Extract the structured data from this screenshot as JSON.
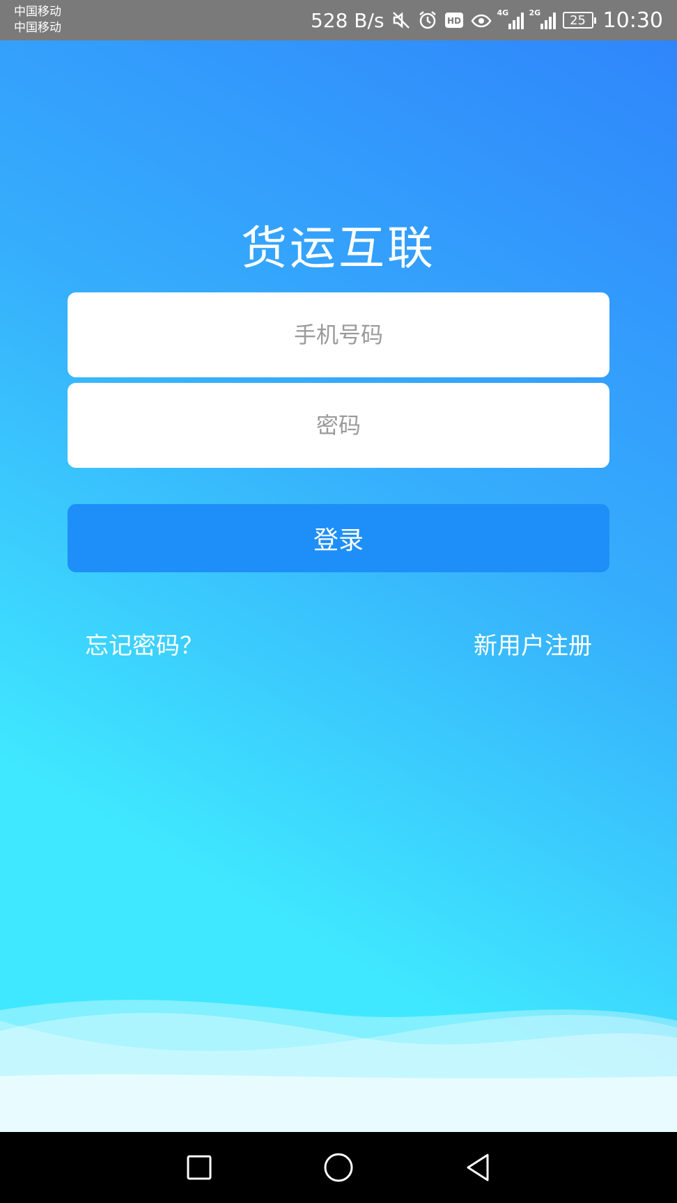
{
  "status_bar": {
    "carrier_1": "中国移动",
    "carrier_2": "中国移动",
    "net_speed": "528 B/s",
    "signal_1_label": "4G",
    "signal_2_label": "2G",
    "battery_level": "25",
    "time": "10:30"
  },
  "app": {
    "title": "货运互联",
    "phone_placeholder": "手机号码",
    "password_placeholder": "密码",
    "login_label": "登录",
    "forgot_password_label": "忘记密码？",
    "register_label": "新用户注册"
  },
  "colors": {
    "gradient_top": "#2f86fb",
    "gradient_bottom": "#3fe8fe",
    "login_button": "#1e8ff8",
    "status_bar": "#7a7a7a"
  },
  "nav_bar": {
    "icons": [
      "recent-apps-icon",
      "home-icon",
      "back-icon"
    ]
  }
}
